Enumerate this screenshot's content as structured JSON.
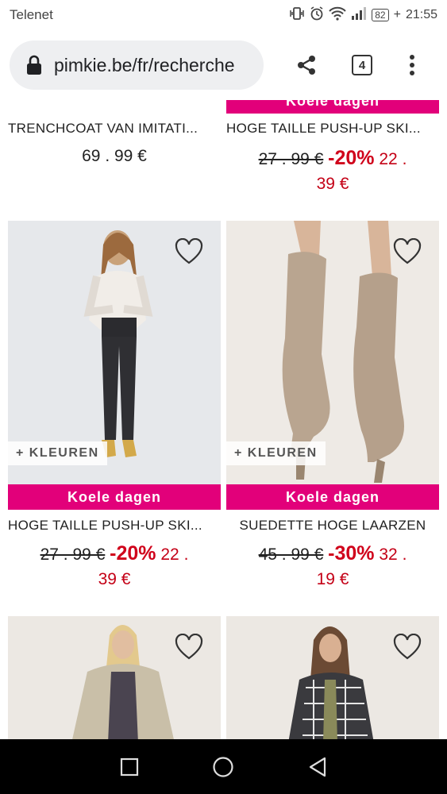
{
  "status_bar": {
    "carrier": "Telenet",
    "battery": "82",
    "time": "21:55"
  },
  "browser": {
    "url": "pimkie.be/fr/recherche",
    "tab_count": "4"
  },
  "products": [
    {
      "title": "TRENCHCOAT VAN IMITATI...",
      "price": "69 . 99 €"
    },
    {
      "promo": "Koele dagen",
      "title": "HOGE TAILLE PUSH-UP SKI...",
      "old_price": "27 . 99 €",
      "discount": "-20%",
      "new_price_a": "22 .",
      "new_price_b": "39 €"
    },
    {
      "promo": "Koele dagen",
      "colors_label": "+ KLEUREN",
      "title": "HOGE TAILLE PUSH-UP SKI...",
      "old_price": "27 . 99 €",
      "discount": "-20%",
      "new_price_a": "22 .",
      "new_price_b": "39 €"
    },
    {
      "promo": "Koele dagen",
      "colors_label": "+ KLEUREN",
      "title": "SUEDETTE HOGE LAARZEN",
      "old_price": "45 . 99 €",
      "discount": "-30%",
      "new_price_a": "32 .",
      "new_price_b": "19 €"
    },
    {},
    {}
  ],
  "icons": [
    "lock-icon",
    "share-icon",
    "menu-dots-icon",
    "heart-icon",
    "square-nav-icon",
    "circle-home-icon",
    "triangle-back-icon"
  ],
  "colors": {
    "promo": "#e2007a",
    "discount": "#d0021b"
  }
}
